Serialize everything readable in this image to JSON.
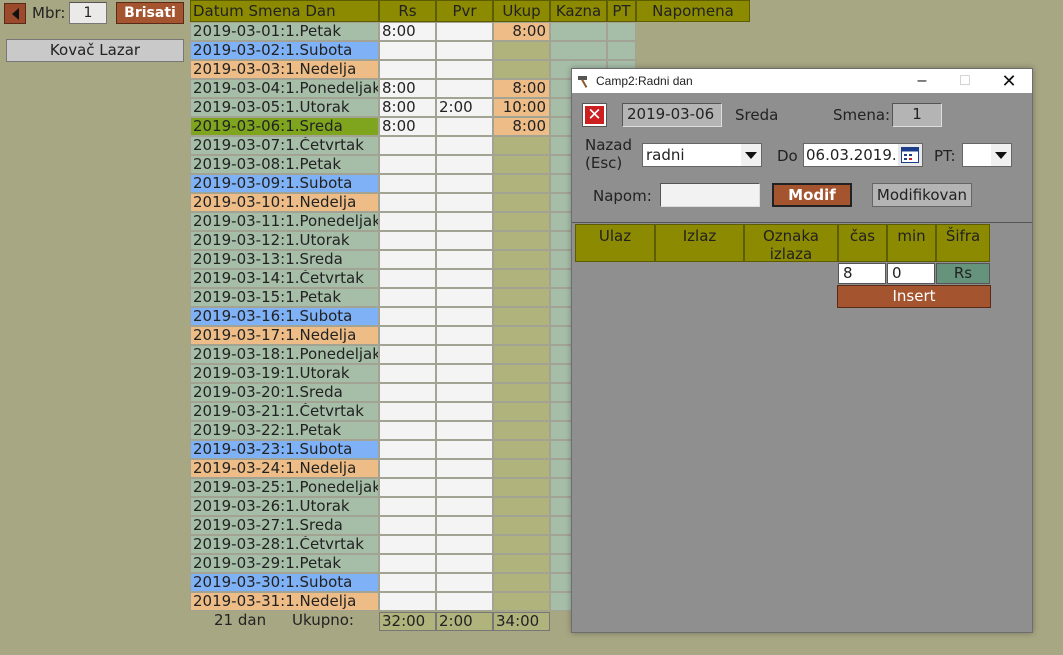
{
  "left_panel": {
    "mbr_label": "Mbr:",
    "mbr_value": "1",
    "brisati_label": "Brisati",
    "employee_name": "Kovač Lazar"
  },
  "grid": {
    "headers": {
      "date": "Datum Smena Dan",
      "rs": "Rs",
      "pvr": "Pvr",
      "ukup": "Ukup",
      "kazna": "Kazna",
      "pt": "PT",
      "napomena": "Napomena"
    },
    "rows": [
      {
        "label": "2019-03-01:1.Petak",
        "type": "weekday",
        "rs": "8:00",
        "pvr": "",
        "ukup": "8:00"
      },
      {
        "label": "2019-03-02:1.Subota",
        "type": "sat",
        "rs": "",
        "pvr": "",
        "ukup": ""
      },
      {
        "label": "2019-03-03:1.Nedelja",
        "type": "sun",
        "rs": "",
        "pvr": "",
        "ukup": ""
      },
      {
        "label": "2019-03-04:1.Ponedeljak",
        "type": "weekday",
        "rs": "8:00",
        "pvr": "",
        "ukup": "8:00"
      },
      {
        "label": "2019-03-05:1.Utorak",
        "type": "weekday",
        "rs": "8:00",
        "pvr": "2:00",
        "ukup": "10:00"
      },
      {
        "label": "2019-03-06:1.Sreda",
        "type": "selected",
        "rs": "8:00",
        "pvr": "",
        "ukup": "8:00"
      },
      {
        "label": "2019-03-07:1.Četvrtak",
        "type": "weekday",
        "rs": "",
        "pvr": "",
        "ukup": ""
      },
      {
        "label": "2019-03-08:1.Petak",
        "type": "weekday",
        "rs": "",
        "pvr": "",
        "ukup": ""
      },
      {
        "label": "2019-03-09:1.Subota",
        "type": "sat",
        "rs": "",
        "pvr": "",
        "ukup": ""
      },
      {
        "label": "2019-03-10:1.Nedelja",
        "type": "sun",
        "rs": "",
        "pvr": "",
        "ukup": ""
      },
      {
        "label": "2019-03-11:1.Ponedeljak",
        "type": "weekday",
        "rs": "",
        "pvr": "",
        "ukup": ""
      },
      {
        "label": "2019-03-12:1.Utorak",
        "type": "weekday",
        "rs": "",
        "pvr": "",
        "ukup": ""
      },
      {
        "label": "2019-03-13:1.Sreda",
        "type": "weekday",
        "rs": "",
        "pvr": "",
        "ukup": ""
      },
      {
        "label": "2019-03-14:1.Četvrtak",
        "type": "weekday",
        "rs": "",
        "pvr": "",
        "ukup": ""
      },
      {
        "label": "2019-03-15:1.Petak",
        "type": "weekday",
        "rs": "",
        "pvr": "",
        "ukup": ""
      },
      {
        "label": "2019-03-16:1.Subota",
        "type": "sat",
        "rs": "",
        "pvr": "",
        "ukup": ""
      },
      {
        "label": "2019-03-17:1.Nedelja",
        "type": "sun",
        "rs": "",
        "pvr": "",
        "ukup": ""
      },
      {
        "label": "2019-03-18:1.Ponedeljak",
        "type": "weekday",
        "rs": "",
        "pvr": "",
        "ukup": ""
      },
      {
        "label": "2019-03-19:1.Utorak",
        "type": "weekday",
        "rs": "",
        "pvr": "",
        "ukup": ""
      },
      {
        "label": "2019-03-20:1.Sreda",
        "type": "weekday",
        "rs": "",
        "pvr": "",
        "ukup": ""
      },
      {
        "label": "2019-03-21:1.Četvrtak",
        "type": "weekday",
        "rs": "",
        "pvr": "",
        "ukup": ""
      },
      {
        "label": "2019-03-22:1.Petak",
        "type": "weekday",
        "rs": "",
        "pvr": "",
        "ukup": ""
      },
      {
        "label": "2019-03-23:1.Subota",
        "type": "sat",
        "rs": "",
        "pvr": "",
        "ukup": ""
      },
      {
        "label": "2019-03-24:1.Nedelja",
        "type": "sun",
        "rs": "",
        "pvr": "",
        "ukup": ""
      },
      {
        "label": "2019-03-25:1.Ponedeljak",
        "type": "weekday",
        "rs": "",
        "pvr": "",
        "ukup": ""
      },
      {
        "label": "2019-03-26:1.Utorak",
        "type": "weekday",
        "rs": "",
        "pvr": "",
        "ukup": ""
      },
      {
        "label": "2019-03-27:1.Sreda",
        "type": "weekday",
        "rs": "",
        "pvr": "",
        "ukup": ""
      },
      {
        "label": "2019-03-28:1.Četvrtak",
        "type": "weekday",
        "rs": "",
        "pvr": "",
        "ukup": ""
      },
      {
        "label": "2019-03-29:1.Petak",
        "type": "weekday",
        "rs": "",
        "pvr": "",
        "ukup": ""
      },
      {
        "label": "2019-03-30:1.Subota",
        "type": "sat",
        "rs": "",
        "pvr": "",
        "ukup": ""
      },
      {
        "label": "2019-03-31:1.Nedelja",
        "type": "sun",
        "rs": "",
        "pvr": "",
        "ukup": ""
      }
    ],
    "footer": {
      "days": "21 dan",
      "ukupno_label": "Ukupno:",
      "rs_total": "32:00",
      "pvr_total": "2:00",
      "ukup_total": "34:00"
    }
  },
  "dialog": {
    "title": "Camp2:Radni dan",
    "date": "2019-03-06",
    "day_name": "Sreda",
    "smena_label": "Smena:",
    "smena_value": "1",
    "nazad_label_line1": "Nazad",
    "nazad_label_line2": "(Esc)",
    "type_value": "radni",
    "do_label": "Do",
    "do_date": "06.03.2019.",
    "pt_label": "PT:",
    "pt_value": "",
    "napom_label": "Napom:",
    "napom_value": "",
    "modif_label": "Modif",
    "modifikovan_label": "Modifikovan",
    "table_headers": {
      "ulaz": "Ulaz",
      "izlaz": "Izlaz",
      "oznaka_line1": "Oznaka",
      "oznaka_line2": "izlaza",
      "cas": "čas",
      "min": "min",
      "sifra": "Šifra"
    },
    "entry": {
      "cas": "8",
      "min": "0",
      "sifra": "Rs"
    },
    "insert_label": "Insert"
  }
}
